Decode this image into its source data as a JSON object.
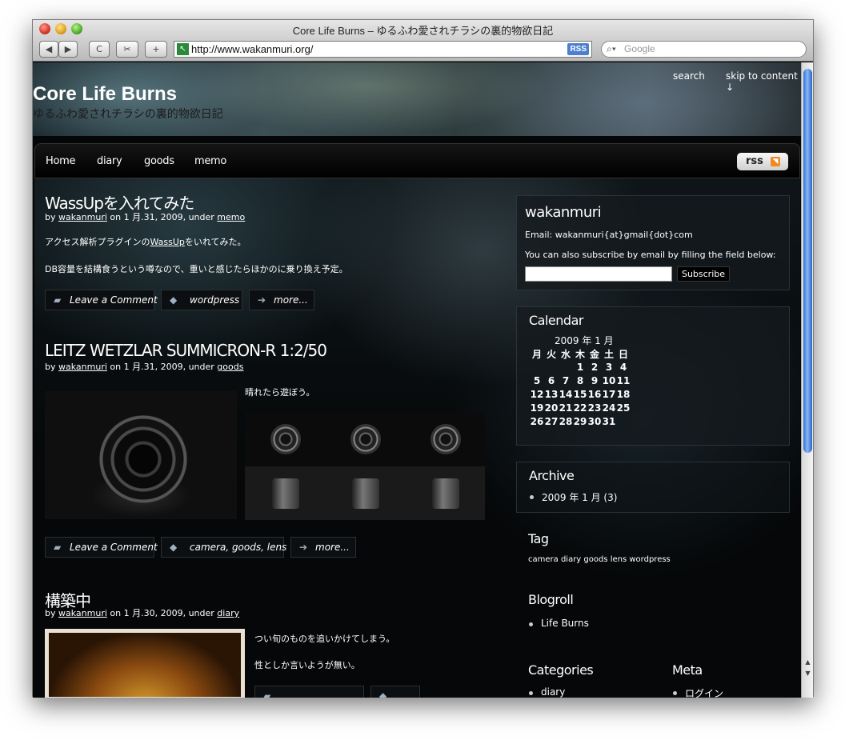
{
  "browser": {
    "window_title": "Core Life Burns – ゆるふわ愛されチラシの裏的物欲日記",
    "back_label": "◀",
    "forward_label": "▶",
    "reload_label": "C",
    "snip_label": "✂",
    "add_label": "+",
    "url": "http://www.wakanmuri.org/",
    "rss_badge": "RSS",
    "search_placeholder": "Google"
  },
  "site": {
    "title": "Core Life Burns",
    "description": "ゆるふわ愛されチラシの裏的物欲日記",
    "search_link": "search",
    "skip_link": "skip to content ↓"
  },
  "nav": {
    "items": [
      "Home",
      "diary",
      "goods",
      "memo"
    ],
    "rss_label": "rss"
  },
  "posts": [
    {
      "title": "WassUpを入れてみた",
      "meta_by": "by ",
      "author": "wakanmuri",
      "meta_on": " on 1 月.31, 2009, under ",
      "category": "memo",
      "line1_pre": "アクセス解析プラグインの",
      "line1_link": "WassUp",
      "line1_post": "をいれてみた。",
      "line2": "DB容量を結構食うという噂なので、重いと感じたらほかのに乗り換え予定。",
      "comment_label": "Leave a Comment",
      "tags_label": "wordpress",
      "more_label": "more..."
    },
    {
      "title": "LEITZ WETZLAR SUMMICRON-R 1:2/50",
      "meta_by": "by ",
      "author": "wakanmuri",
      "meta_on": " on 1 月.31, 2009, under ",
      "category": "goods",
      "line1": "晴れたら遊ぼう。",
      "comment_label": "Leave a Comment",
      "tags_label": "camera, goods, lens",
      "more_label": "more..."
    },
    {
      "title": "構築中",
      "meta_by": "by ",
      "author": "wakanmuri",
      "meta_on": " on 1 月.30, 2009, under ",
      "category": "diary",
      "line1": "つい旬のものを追いかけてしまう。",
      "line2": "性としか言いようが無い。"
    }
  ],
  "sidebar": {
    "profile": {
      "title": "wakanmuri",
      "email": "Email: wakanmuri{at}gmail{dot}com",
      "subscribe_text": "You can also subscribe by email by filling the field below:",
      "subscribe_button": "Subscribe"
    },
    "calendar": {
      "title": "Calendar",
      "caption": "2009 年 1 月",
      "weekdays": [
        "月",
        "火",
        "水",
        "木",
        "金",
        "土",
        "日"
      ],
      "weeks": [
        [
          "",
          "",
          "",
          "1",
          "2",
          "3",
          "4"
        ],
        [
          "5",
          "6",
          "7",
          "8",
          "9",
          "10",
          "11"
        ],
        [
          "12",
          "13",
          "14",
          "15",
          "16",
          "17",
          "18"
        ],
        [
          "19",
          "20",
          "21",
          "22",
          "23",
          "24",
          "25"
        ],
        [
          "26",
          "27",
          "28",
          "29",
          "30",
          "31",
          ""
        ]
      ]
    },
    "archive": {
      "title": "Archive",
      "items": [
        "2009 年 1 月 (3)"
      ]
    },
    "tag": {
      "title": "Tag",
      "cloud": "camera diary goods lens wordpress"
    },
    "blogroll": {
      "title": "Blogroll",
      "items": [
        "Life Burns"
      ]
    },
    "categories": {
      "title": "Categories",
      "items": [
        "diary"
      ]
    },
    "meta": {
      "title": "Meta",
      "items": [
        "ログイン"
      ]
    }
  }
}
